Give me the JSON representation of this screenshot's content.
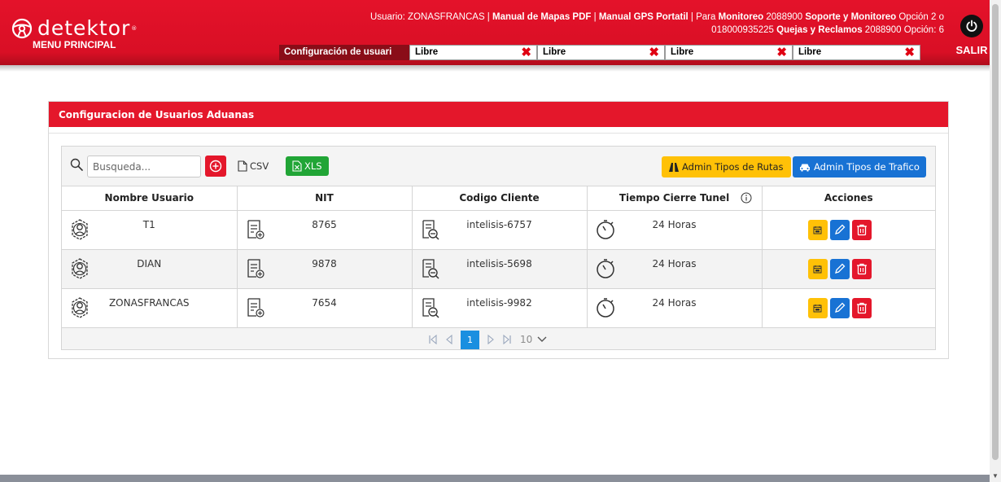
{
  "header": {
    "logo_text": "detektor",
    "logo_tm": "®",
    "menu_label": "MENU PRINCIPAL",
    "user_line1_prefix": "Usuario: ZONASFRANCAS | ",
    "user_link_manual_mapas": "Manual de Mapas PDF",
    "user_sep1": " | ",
    "user_link_manual_gps": "Manual GPS Portatil",
    "user_line1_mid": " | Para ",
    "user_monitoreo": "Monitoreo",
    "user_monitoreo_num": " 2088900 ",
    "user_soporte": "Soporte y Monitoreo",
    "user_opcion2": " Opción 2 o",
    "user_line2_num": "018000935225 ",
    "user_quejas": "Quejas y Reclamos",
    "user_line2_end": " 2088900 Opción: 6",
    "logout_label": "SALIR"
  },
  "tabs": {
    "active": "Configuración de usuari",
    "free": [
      "Libre",
      "Libre",
      "Libre",
      "Libre"
    ],
    "close_glyph": "✖"
  },
  "card": {
    "title": "Configuracion de Usuarios Aduanas"
  },
  "toolbar": {
    "search_placeholder": "Busqueda...",
    "csv_label": "CSV",
    "xls_label": "XLS",
    "rutas_label": "Admin Tipos de Rutas",
    "trafico_label": "Admin Tipos de Trafico"
  },
  "table": {
    "columns": [
      "Nombre Usuario",
      "NIT",
      "Codigo Cliente",
      "Tiempo Cierre Tunel",
      "Acciones"
    ],
    "rows": [
      {
        "nombre": "T1",
        "nit": "8765",
        "codigo": "intelisis-6757",
        "tiempo": "24 Horas"
      },
      {
        "nombre": "DIAN",
        "nit": "9878",
        "codigo": "intelisis-5698",
        "tiempo": "24 Horas"
      },
      {
        "nombre": "ZONASFRANCAS",
        "nit": "7654",
        "codigo": "intelisis-9982",
        "tiempo": "24 Horas"
      }
    ]
  },
  "pager": {
    "current_page": "1",
    "page_size": "10"
  },
  "colors": {
    "brand_red": "#e4172b",
    "warning_yellow": "#ffc107",
    "primary_blue": "#1872d4",
    "success_green": "#21a536"
  }
}
